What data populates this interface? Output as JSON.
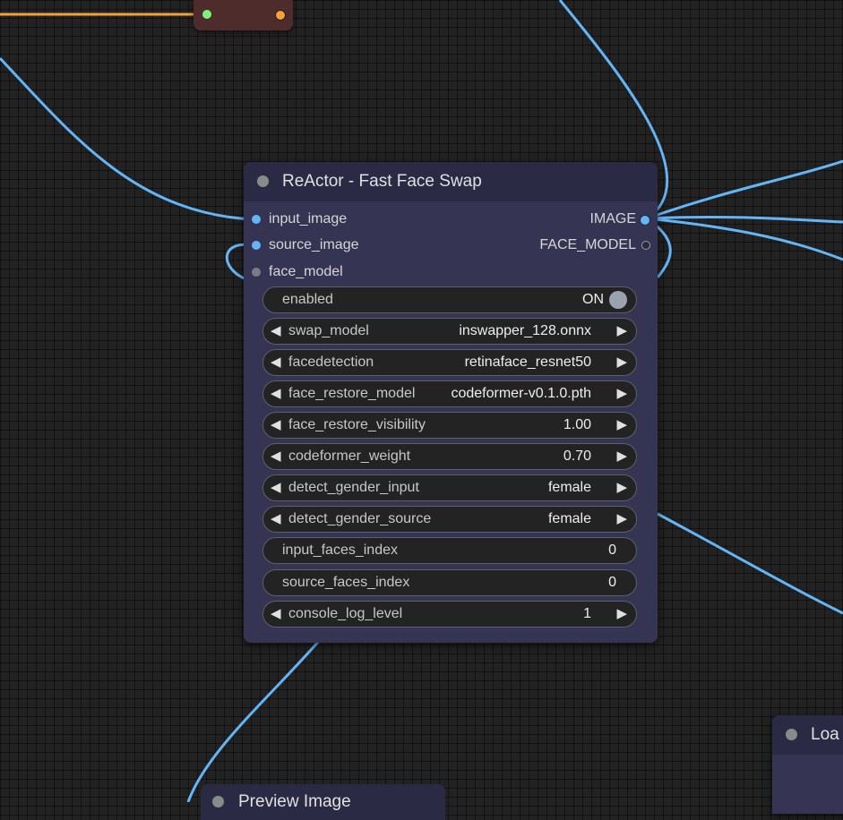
{
  "colors": {
    "canvas": "#222222",
    "node_body": "#353553",
    "node_title": "#2a2a44",
    "wire_image": "#64b5f6",
    "wire_orange": "#f2a23a",
    "mini_node": "#4f2c2c"
  },
  "reactor": {
    "title": "ReActor - Fast Face Swap",
    "inputs": [
      {
        "label": "input_image"
      },
      {
        "label": "source_image"
      },
      {
        "label": "face_model"
      }
    ],
    "outputs": [
      {
        "label": "IMAGE"
      },
      {
        "label": "FACE_MODEL"
      }
    ],
    "widgets": [
      {
        "label": "enabled",
        "value": "ON"
      },
      {
        "label": "swap_model",
        "value": "inswapper_128.onnx"
      },
      {
        "label": "facedetection",
        "value": "retinaface_resnet50"
      },
      {
        "label": "face_restore_model",
        "value": "codeformer-v0.1.0.pth"
      },
      {
        "label": "face_restore_visibility",
        "value": "1.00"
      },
      {
        "label": "codeformer_weight",
        "value": "0.70"
      },
      {
        "label": "detect_gender_input",
        "value": "female"
      },
      {
        "label": "detect_gender_source",
        "value": "female"
      },
      {
        "label": "input_faces_index",
        "value": "0"
      },
      {
        "label": "source_faces_index",
        "value": "0"
      },
      {
        "label": "console_log_level",
        "value": "1"
      }
    ]
  },
  "load_node": {
    "title": "Loa"
  },
  "preview_node": {
    "title": "Preview Image"
  }
}
